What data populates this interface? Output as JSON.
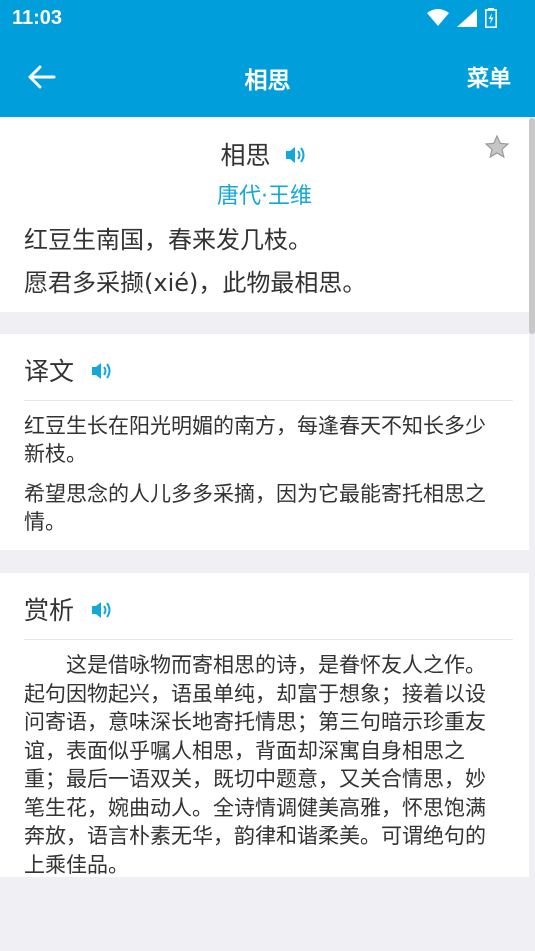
{
  "status_bar": {
    "time": "11:03"
  },
  "header": {
    "title": "相思",
    "menu_label": "菜单"
  },
  "poem": {
    "title": "相思",
    "author": "唐代·王维",
    "lines": [
      "红豆生南国，春来发几枝。",
      "愿君多采撷(xié)，此物最相思。"
    ]
  },
  "translation": {
    "heading": "译文",
    "paragraphs": [
      "红豆生长在阳光明媚的南方，每逢春天不知长多少新枝。",
      "希望思念的人儿多多采摘，因为它最能寄托相思之情。"
    ]
  },
  "appreciation": {
    "heading": "赏析",
    "text": "这是借咏物而寄相思的诗，是眷怀友人之作。起句因物起兴，语虽单纯，却富于想象；接着以设问寄语，意味深长地寄托情思；第三句暗示珍重友谊，表面似乎嘱人相思，背面却深寓自身相思之重；最后一语双关，既切中题意，又关合情思，妙笔生花，婉曲动人。全诗情调健美高雅，怀思饱满奔放，语言朴素无华，韵律和谐柔美。可谓绝句的上乘佳品。"
  },
  "colors": {
    "header": "#009fdb",
    "accent": "#12a8d8",
    "background": "#efeff4"
  },
  "icons": [
    "wifi-icon",
    "signal-icon",
    "battery-icon",
    "back-arrow-icon",
    "speaker-icon",
    "star-icon"
  ]
}
